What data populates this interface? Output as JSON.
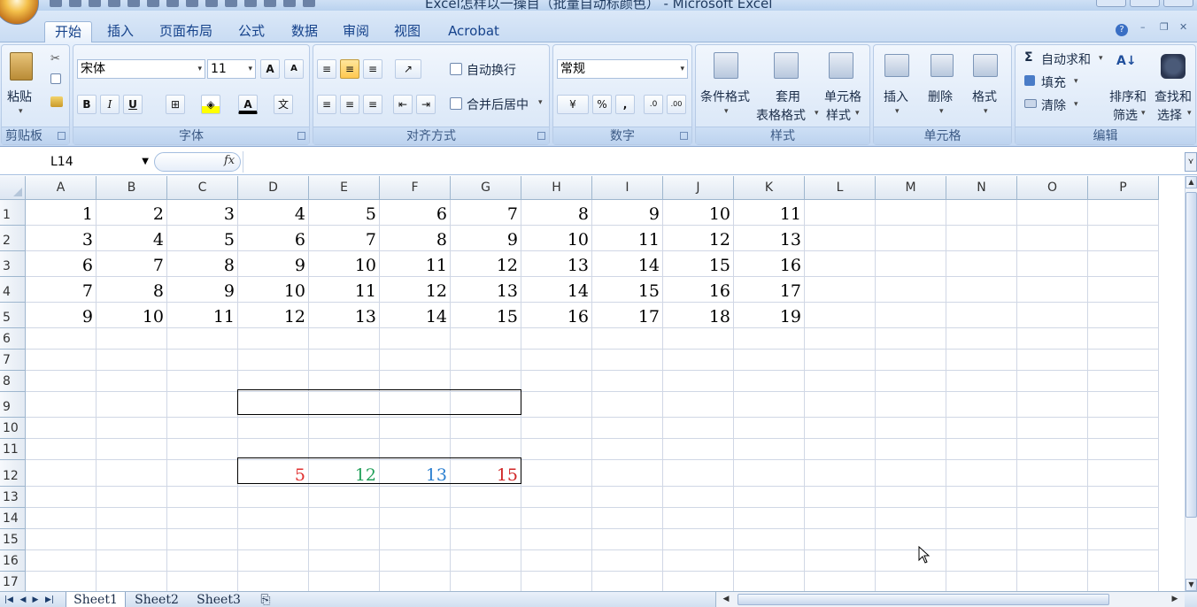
{
  "window": {
    "title": "Excel怎样以一操目（批量自动标颜色） - Microsoft Excel"
  },
  "ribbon": {
    "tabs": [
      "开始",
      "插入",
      "页面布局",
      "公式",
      "数据",
      "审阅",
      "视图",
      "Acrobat"
    ],
    "clipboard": {
      "paste_label": "粘贴",
      "group_label": "剪贴板"
    },
    "font": {
      "name": "宋体",
      "size": "11",
      "grow": "A",
      "shrink": "A",
      "bold": "B",
      "italic": "I",
      "underline": "U",
      "font_color_glyph": "A",
      "phonetic": "文",
      "group_label": "字体"
    },
    "alignment": {
      "wrap_label": "自动换行",
      "merge_label": "合并后居中",
      "group_label": "对齐方式"
    },
    "number": {
      "format": "常规",
      "percent": "%",
      "comma": ",",
      "inc_decimal": ".0",
      "dec_decimal": ".00",
      "group_label": "数字"
    },
    "styles": {
      "conditional_label": "条件格式",
      "table_label_1": "套用",
      "table_label_2": "表格格式",
      "cell_style_1": "单元格",
      "cell_style_2": "样式",
      "group_label": "样式"
    },
    "cells": {
      "insert_label": "插入",
      "delete_label": "删除",
      "format_label": "格式",
      "group_label": "单元格"
    },
    "editing": {
      "autosum_label": "自动求和",
      "fill_label": "填充",
      "clear_label": "清除",
      "sort_1": "排序和",
      "sort_2": "筛选",
      "find_1": "查找和",
      "find_2": "选择",
      "group_label": "编辑"
    }
  },
  "formula_bar": {
    "name_box": "L14",
    "fx": "fx",
    "formula": ""
  },
  "sheet": {
    "columns": [
      "A",
      "B",
      "C",
      "D",
      "E",
      "F",
      "G",
      "H",
      "I",
      "J",
      "K",
      "L",
      "M",
      "N",
      "O",
      "P"
    ],
    "rows": [
      "1",
      "2",
      "3",
      "4",
      "5",
      "6",
      "7",
      "8",
      "9",
      "10",
      "11",
      "12",
      "13",
      "14",
      "15",
      "16",
      "17"
    ],
    "data": [
      [
        "1",
        "2",
        "3",
        "4",
        "5",
        "6",
        "7",
        "8",
        "9",
        "10",
        "11"
      ],
      [
        "3",
        "4",
        "5",
        "6",
        "7",
        "8",
        "9",
        "10",
        "11",
        "12",
        "13"
      ],
      [
        "6",
        "7",
        "8",
        "9",
        "10",
        "11",
        "12",
        "13",
        "14",
        "15",
        "16"
      ],
      [
        "7",
        "8",
        "9",
        "10",
        "11",
        "12",
        "13",
        "14",
        "15",
        "16",
        "17"
      ],
      [
        "9",
        "10",
        "11",
        "12",
        "13",
        "14",
        "15",
        "16",
        "17",
        "18",
        "19"
      ]
    ],
    "row12": [
      {
        "value": "5",
        "color": "#e03030"
      },
      {
        "value": "12",
        "color": "#22a05a"
      },
      {
        "value": "13",
        "color": "#2a7fd0"
      },
      {
        "value": "15",
        "color": "#d02525"
      }
    ]
  },
  "sheet_tabs": [
    "Sheet1",
    "Sheet2",
    "Sheet3"
  ]
}
